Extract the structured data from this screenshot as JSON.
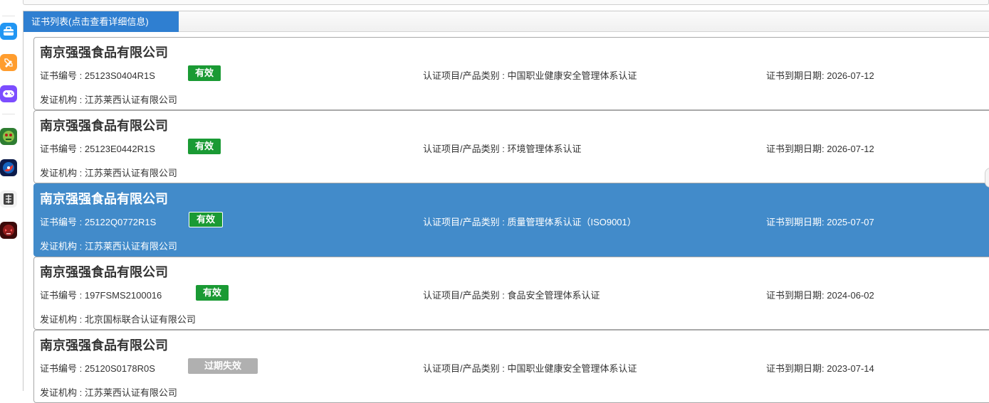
{
  "panel": {
    "tab_label": "证书列表(点击查看详细信息)"
  },
  "dock_icons": [
    "toolbox-icon",
    "pencil-ruler-icon",
    "gamepad-icon",
    "zombie-game-icon",
    "planet-game-icon",
    "dragon-char-icon",
    "red-monster-game-icon"
  ],
  "labels": {
    "cert_no": "证书编号 : ",
    "scope": "认证项目/产品类别 : ",
    "expiry": "证书到期日期: ",
    "issuer": "发证机构 : "
  },
  "certificates": [
    {
      "company": "南京强强食品有限公司",
      "cert_no": "25123S0404R1S",
      "status": "有效",
      "scope": "中国职业健康安全管理体系认证",
      "expiry": "2026-07-12",
      "issuer": "江苏莱西认证有限公司"
    },
    {
      "company": "南京强强食品有限公司",
      "cert_no": "25123E0442R1S",
      "status": "有效",
      "scope": "环境管理体系认证",
      "expiry": "2026-07-12",
      "issuer": "江苏莱西认证有限公司"
    },
    {
      "company": "南京强强食品有限公司",
      "cert_no": "25122Q0772R1S",
      "status": "有效",
      "scope": "质量管理体系认证（ISO9001）",
      "expiry": "2025-07-07",
      "issuer": "江苏莱西认证有限公司"
    },
    {
      "company": "南京强强食品有限公司",
      "cert_no": "197FSMS2100016",
      "status": "有效",
      "scope": "食品安全管理体系认证",
      "expiry": "2024-06-02",
      "issuer": "北京国标联合认证有限公司"
    },
    {
      "company": "南京强强食品有限公司",
      "cert_no": "25120S0178R0S",
      "status": "过期失效",
      "scope": "中国职业健康安全管理体系认证",
      "expiry": "2023-07-14",
      "issuer": "江苏莱西认证有限公司"
    }
  ],
  "colors": {
    "accent": "#2f7fd1",
    "selected_row": "#428bca",
    "valid_badge": "#1a9a34",
    "expired_badge": "#b0b0b0"
  }
}
